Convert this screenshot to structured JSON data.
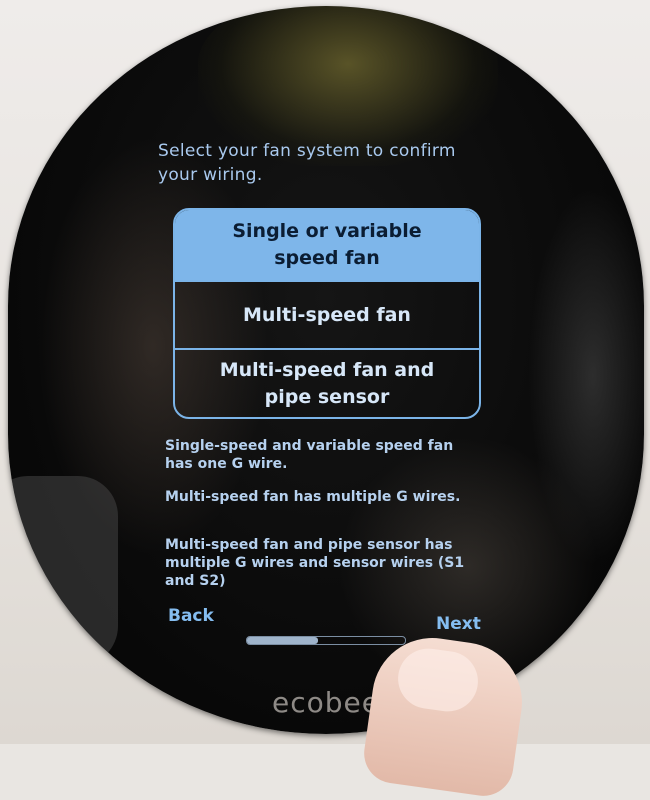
{
  "screen": {
    "prompt": "Select your fan system to confirm your wiring.",
    "options": [
      {
        "label": "Single or variable speed fan",
        "selected": true
      },
      {
        "label": "Multi-speed fan",
        "selected": false
      },
      {
        "label": "Multi-speed fan and pipe sensor",
        "selected": false
      }
    ],
    "descriptions": [
      "Single-speed and variable speed fan has one G wire.",
      "Multi-speed fan has multiple G wires.",
      "Multi-speed fan and pipe sensor has multiple G wires and sensor wires (S1 and S2)"
    ],
    "back_label": "Back",
    "next_label": "Next",
    "progress": 0.45
  },
  "device": {
    "brand": "ecobee"
  },
  "colors": {
    "accent": "#7eb6ea",
    "text": "#a9c9ee",
    "device": "#0b0b0b"
  }
}
